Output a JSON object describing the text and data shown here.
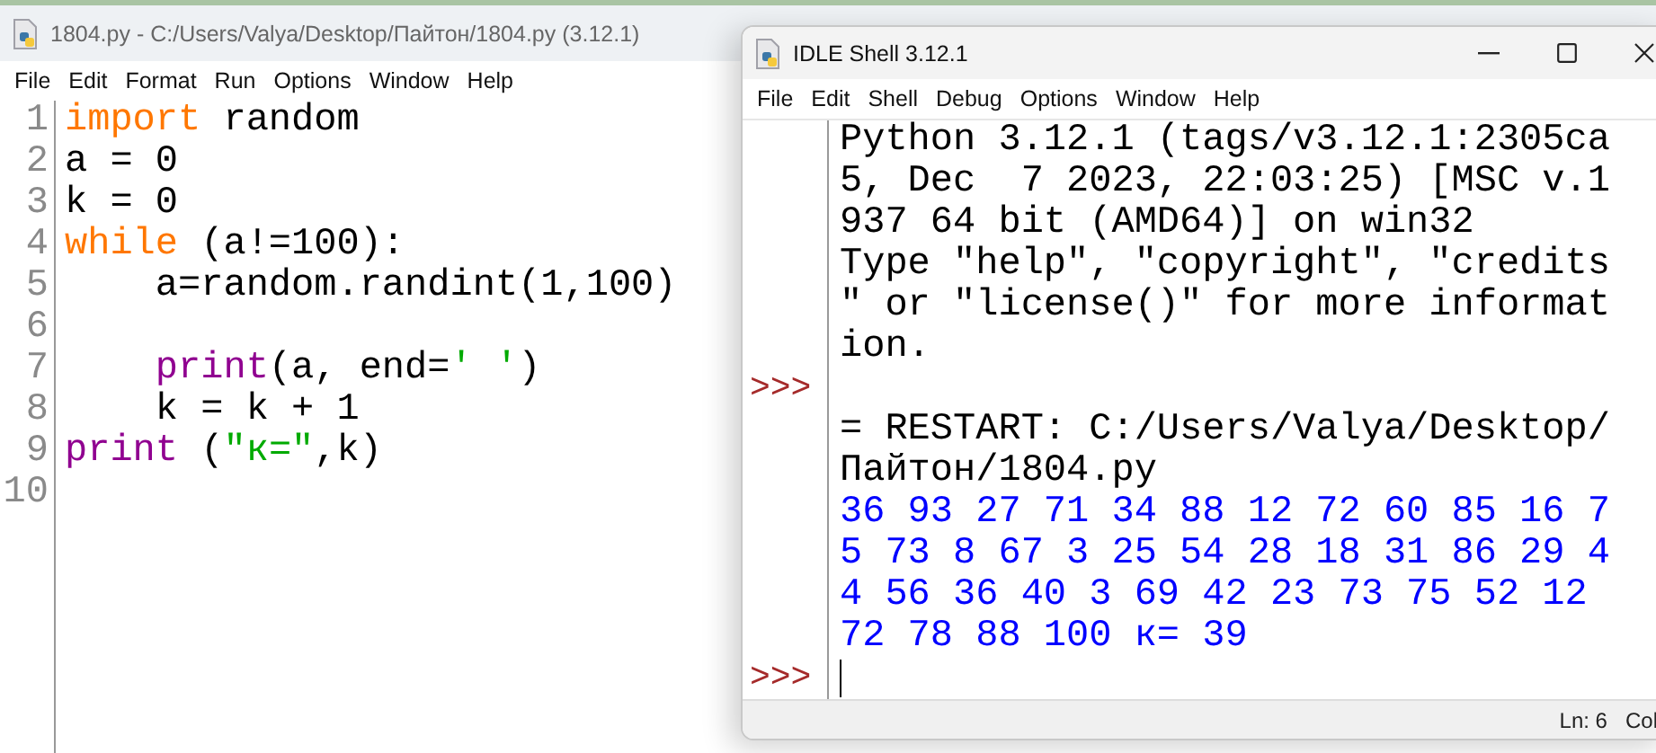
{
  "editor": {
    "title": "1804.py - C:/Users/Valya/Desktop/Пайтон/1804.py (3.12.1)",
    "menu": [
      "File",
      "Edit",
      "Format",
      "Run",
      "Options",
      "Window",
      "Help"
    ],
    "lines": [
      {
        "number": "1",
        "tokens": [
          {
            "kind": "keyword",
            "text": "import"
          },
          {
            "kind": "plain",
            "text": " random"
          }
        ]
      },
      {
        "number": "2",
        "tokens": [
          {
            "kind": "plain",
            "text": "a = 0"
          }
        ]
      },
      {
        "number": "3",
        "tokens": [
          {
            "kind": "plain",
            "text": "k = 0"
          }
        ]
      },
      {
        "number": "4",
        "tokens": [
          {
            "kind": "keyword",
            "text": "while"
          },
          {
            "kind": "plain",
            "text": " (a!=100):"
          }
        ]
      },
      {
        "number": "5",
        "tokens": [
          {
            "kind": "plain",
            "text": "    a=random.randint(1,100)"
          }
        ]
      },
      {
        "number": "6"
      },
      {
        "number": "7",
        "tokens": [
          {
            "kind": "builtin",
            "text": "    print"
          },
          {
            "kind": "plain",
            "text": "(a, end="
          },
          {
            "kind": "string",
            "text": "' '"
          },
          {
            "kind": "plain",
            "text": ")"
          }
        ]
      },
      {
        "number": "8",
        "tokens": [
          {
            "kind": "plain",
            "text": "    k = k + 1"
          }
        ]
      },
      {
        "number": "9",
        "tokens": [
          {
            "kind": "builtin",
            "text": "print"
          },
          {
            "kind": "plain",
            "text": " ("
          },
          {
            "kind": "string",
            "text": "\"к=\""
          },
          {
            "kind": "plain",
            "text": ",k)"
          }
        ]
      },
      {
        "number": "10"
      }
    ]
  },
  "shell": {
    "title": "IDLE Shell 3.12.1",
    "menu": [
      "File",
      "Edit",
      "Shell",
      "Debug",
      "Options",
      "Window",
      "Help"
    ],
    "rows": [
      {
        "kind": "console",
        "text": "Python 3.12.1 (tags/v3.12.1:2305ca"
      },
      {
        "kind": "console",
        "text": "5, Dec  7 2023, 22:03:25) [MSC v.1"
      },
      {
        "kind": "console",
        "text": "937 64 bit (AMD64)] on win32"
      },
      {
        "kind": "console",
        "text": "Type \"help\", \"copyright\", \"credits"
      },
      {
        "kind": "console",
        "text": "\" or \"license()\" for more informat"
      },
      {
        "kind": "console",
        "text": "ion."
      },
      {
        "prompt": ">>>"
      },
      {
        "kind": "console",
        "text": "= RESTART: C:/Users/Valya/Desktop/"
      },
      {
        "kind": "console",
        "text": "Пайтон/1804.py"
      },
      {
        "kind": "stdout",
        "text": "36 93 27 71 34 88 12 72 60 85 16 7"
      },
      {
        "kind": "stdout",
        "text": "5 73 8 67 3 25 54 28 18 31 86 29 4"
      },
      {
        "kind": "stdout",
        "text": "4 56 36 40 3 69 42 23 73 75 52 12"
      },
      {
        "kind": "stdout",
        "text": "72 78 88 100 к= 39"
      },
      {
        "prompt": ">>>",
        "cursor": true
      }
    ],
    "status": [
      "Ln: 6",
      "Col"
    ]
  }
}
